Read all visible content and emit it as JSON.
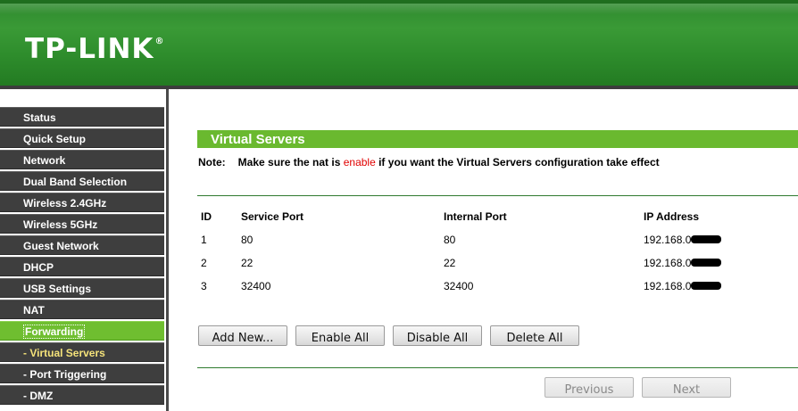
{
  "header": {
    "logo": "TP-LINK",
    "logo_mark": "®"
  },
  "sidebar": {
    "items": [
      {
        "label": "Status"
      },
      {
        "label": "Quick Setup"
      },
      {
        "label": "Network"
      },
      {
        "label": "Dual Band Selection"
      },
      {
        "label": "Wireless 2.4GHz"
      },
      {
        "label": "Wireless 5GHz"
      },
      {
        "label": "Guest Network"
      },
      {
        "label": "DHCP"
      },
      {
        "label": "USB Settings"
      },
      {
        "label": "NAT"
      },
      {
        "label": "Forwarding"
      },
      {
        "label": "- Virtual Servers"
      },
      {
        "label": "- Port Triggering"
      },
      {
        "label": "- DMZ"
      }
    ],
    "active_index": 10,
    "active_sub_index": 11
  },
  "main": {
    "title": "Virtual Servers",
    "note_label": "Note:",
    "note_before": "Make sure the nat is ",
    "note_highlight": "enable",
    "note_after": " if you want the Virtual Servers configuration take effect",
    "table": {
      "headers": [
        "ID",
        "Service Port",
        "Internal Port",
        "IP Address"
      ],
      "rows": [
        {
          "id": "1",
          "service_port": "80",
          "internal_port": "80",
          "ip": "192.168.0"
        },
        {
          "id": "2",
          "service_port": "22",
          "internal_port": "22",
          "ip": "192.168.0"
        },
        {
          "id": "3",
          "service_port": "32400",
          "internal_port": "32400",
          "ip": "192.168.0"
        }
      ]
    },
    "buttons": {
      "add_new": "Add New...",
      "enable_all": "Enable All",
      "disable_all": "Disable All",
      "delete_all": "Delete All",
      "previous": "Previous",
      "next": "Next"
    }
  },
  "colors": {
    "header_green": "#2f8a2f",
    "title_bar_green": "#6ab92f",
    "sidebar_dark": "#3e3e3e",
    "sidebar_active": "#6fbe30",
    "warning_red": "#e00000"
  }
}
